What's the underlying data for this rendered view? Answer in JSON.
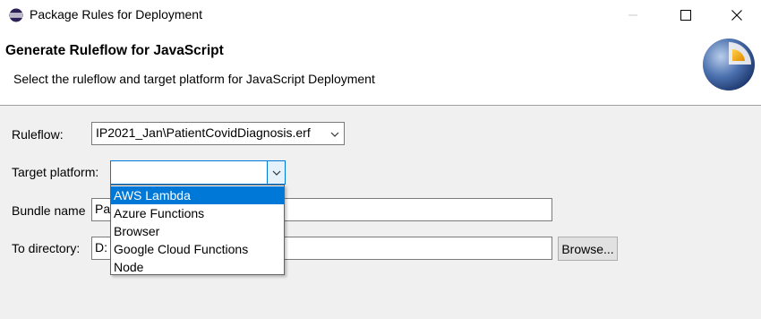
{
  "window": {
    "title": "Package Rules for Deployment",
    "icon": "eclipse-icon",
    "controls": [
      "minimize-icon",
      "maximize-icon",
      "close-icon"
    ]
  },
  "header": {
    "title": "Generate Ruleflow for JavaScript",
    "description": "Select the ruleflow and target platform for JavaScript Deployment",
    "logo": "wizard-banner-logo"
  },
  "form": {
    "ruleflow": {
      "label": "Ruleflow:",
      "value": "IP2021_Jan\\PatientCovidDiagnosis.erf"
    },
    "target_platform": {
      "label": "Target platform:",
      "value": "",
      "options": [
        "AWS Lambda",
        "Azure Functions",
        "Browser",
        "Google Cloud Functions",
        "Node"
      ],
      "highlighted": "AWS Lambda"
    },
    "bundle_name": {
      "label": "Bundle name",
      "value_visible": "Pa"
    },
    "to_directory": {
      "label": "To directory:",
      "value_visible": "D:",
      "browse_label": "Browse..."
    }
  },
  "colors": {
    "selection": "#0078d7",
    "background": "#f0f0f0",
    "header_bg": "#ffffff"
  }
}
